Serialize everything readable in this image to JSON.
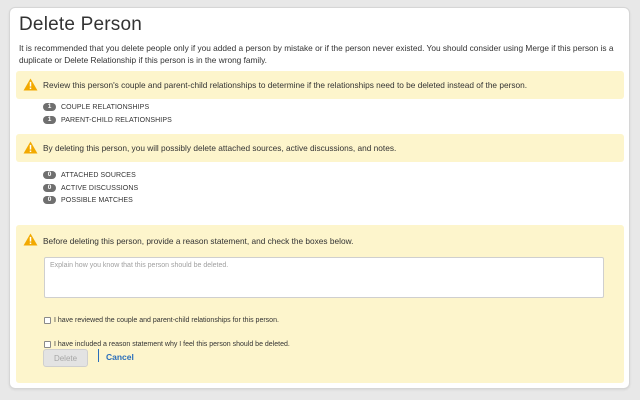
{
  "dialog": {
    "title": "Delete Person",
    "intro": "It is recommended that you delete people only if you added a person by mistake or if the person never existed. You should consider using Merge if this person is a duplicate or Delete Relationship if this person is in the wrong family."
  },
  "relationships_warning": {
    "text": "Review this person's couple and parent-child relationships to determine if the relationships need to be deleted instead of the person.",
    "items": [
      {
        "count": "1",
        "label": "COUPLE RELATIONSHIPS"
      },
      {
        "count": "1",
        "label": "PARENT-CHILD RELATIONSHIPS"
      }
    ]
  },
  "attachments_warning": {
    "text": "By deleting this person, you will possibly delete attached sources, active discussions, and notes.",
    "items": [
      {
        "count": "0",
        "label": "ATTACHED SOURCES"
      },
      {
        "count": "0",
        "label": "ACTIVE DISCUSSIONS"
      },
      {
        "count": "0",
        "label": "POSSIBLE MATCHES"
      }
    ]
  },
  "reason_section": {
    "text": "Before deleting this person, provide a reason statement, and check the boxes below.",
    "reason_value": "",
    "reason_placeholder": "Explain how you know that this person should be deleted.",
    "check_relationships_label": "I have reviewed the couple and parent-child relationships for this person.",
    "check_reason_label": "I have included a reason statement why I feel this person should be deleted."
  },
  "actions": {
    "delete_label": "Delete",
    "cancel_label": "Cancel"
  },
  "colors": {
    "warning_bg": "#fdf5cc",
    "warning_icon": "#f2a900",
    "link": "#2a6ebb",
    "badge": "#6f6f6f"
  }
}
